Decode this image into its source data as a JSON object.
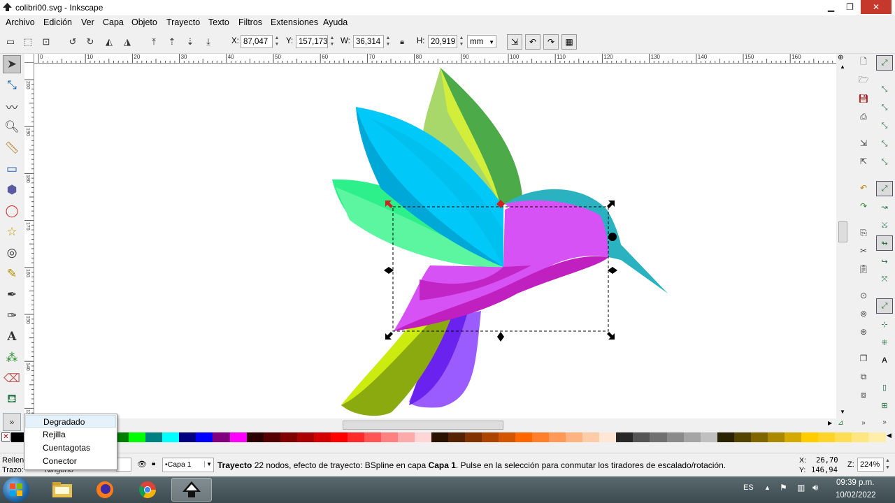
{
  "window": {
    "title": "colibri00.svg - Inkscape",
    "minimize": "▁",
    "maximize": "❐",
    "close": "✕"
  },
  "menu": [
    "Archivo",
    "Edición",
    "Ver",
    "Capa",
    "Objeto",
    "Trayecto",
    "Texto",
    "Filtros",
    "Extensiones",
    "Ayuda"
  ],
  "coords": {
    "x_label": "X:",
    "x": "87,047",
    "y_label": "Y:",
    "y": "157,173",
    "w_label": "W:",
    "w": "36,314",
    "h_label": "H:",
    "h": "20,919",
    "unit": "mm"
  },
  "ruler_top": [
    "0",
    "10",
    "20",
    "30",
    "40",
    "50",
    "60",
    "70",
    "80",
    "90",
    "100",
    "110",
    "120",
    "130",
    "140",
    "150",
    "160"
  ],
  "ruler_left": [
    "200",
    "190",
    "180",
    "170",
    "160",
    "150",
    "140",
    "130"
  ],
  "dropdown": {
    "items": [
      "Degradado",
      "Rejilla",
      "Cuentagotas",
      "Conector"
    ],
    "highlighted": 0
  },
  "status": {
    "fill_label": "Relleno",
    "stroke_label": "Trazo:",
    "stroke_value": "Ninguno",
    "layer": "•Capa 1",
    "message_bold": "Trayecto",
    "message": " 22 nodos, efecto de trayecto: BSpline en capa ",
    "message_layer": "Capa 1",
    "message_end": ". Pulse en la selección para conmutar los tiradores de escalado/rotación.",
    "cursor_x_label": "X:",
    "cursor_x": "26,70",
    "cursor_y_label": "Y:",
    "cursor_y": "146,94",
    "zoom_label": "Z:",
    "zoom": "224%"
  },
  "taskbar": {
    "language": "ES",
    "time": "09:39 p.m.",
    "date": "10/02/2022"
  },
  "palette_colors": [
    "#000000",
    "#ffffff",
    "#800000",
    "#ff0000",
    "#808000",
    "#ffff00",
    "#008000",
    "#00ff00",
    "#008080",
    "#00ffff",
    "#000080",
    "#0000ff",
    "#800080",
    "#ff00ff",
    "#2a0000",
    "#550000",
    "#800000",
    "#aa0000",
    "#d40000",
    "#ff0000",
    "#ff2a2a",
    "#ff5555",
    "#ff8080",
    "#ffaaaa",
    "#ffd5d5",
    "#2b1100",
    "#552200",
    "#803300",
    "#aa4400",
    "#d45500",
    "#ff6600",
    "#ff7f2a",
    "#ff9955",
    "#ffb380",
    "#ffccaa",
    "#ffe6d5",
    "#282828",
    "#555555",
    "#707070",
    "#8a8a8a",
    "#a5a5a5",
    "#c0c0c0",
    "#2b2200",
    "#554400",
    "#806600",
    "#aa8800",
    "#d4aa00",
    "#ffcc00",
    "#ffd42a",
    "#ffdd55",
    "#ffe680",
    "#ffeeaa"
  ]
}
